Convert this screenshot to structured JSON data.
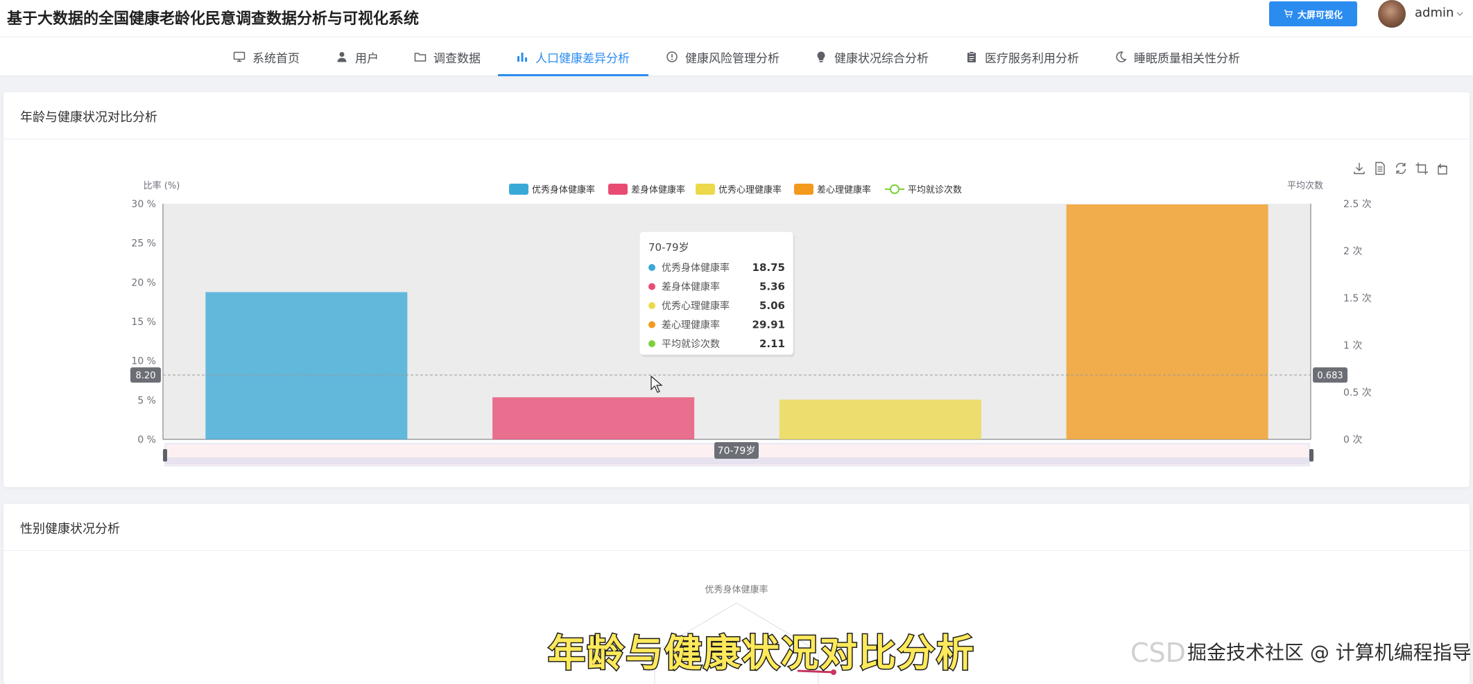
{
  "app": {
    "title": "基于大数据的全国健康老龄化民意调查数据分析与可视化系统",
    "bigscreen_label": "大屏可视化",
    "user": "admin"
  },
  "nav": {
    "items": [
      {
        "label": "系统首页",
        "icon": "monitor-icon"
      },
      {
        "label": "用户",
        "icon": "user-icon"
      },
      {
        "label": "调查数据",
        "icon": "folder-icon"
      },
      {
        "label": "人口健康差异分析",
        "icon": "bar-chart-icon",
        "active": true
      },
      {
        "label": "健康风险管理分析",
        "icon": "info-circle-icon"
      },
      {
        "label": "健康状况综合分析",
        "icon": "lightbulb-icon"
      },
      {
        "label": "医疗服务利用分析",
        "icon": "clipboard-icon"
      },
      {
        "label": "睡眠质量相关性分析",
        "icon": "moon-icon"
      }
    ]
  },
  "card1": {
    "title": "年龄与健康状况对比分析"
  },
  "card2": {
    "title": "性别健康状况分析"
  },
  "chart_data": [
    {
      "type": "bar",
      "ylabel_left": "比率 (%)",
      "ylabel_right": "平均次数",
      "y_left": {
        "min": 0,
        "max": 30,
        "ticks": [
          0,
          5,
          10,
          15,
          20,
          25,
          30
        ],
        "tick_suffix": " %"
      },
      "y_right": {
        "min": 0,
        "max": 2.5,
        "ticks": [
          0,
          0.5,
          1,
          1.5,
          2,
          2.5
        ],
        "tick_suffix": " 次"
      },
      "categories": [
        "70-79岁"
      ],
      "series": [
        {
          "name": "优秀身体健康率",
          "color": "#3ba9d6",
          "values": [
            18.75
          ],
          "type": "bar"
        },
        {
          "name": "差身体健康率",
          "color": "#e84c73",
          "values": [
            5.36
          ],
          "type": "bar"
        },
        {
          "name": "优秀心理健康率",
          "color": "#ecd84a",
          "values": [
            5.06
          ],
          "type": "bar"
        },
        {
          "name": "差心理健康率",
          "color": "#f29a1e",
          "values": [
            29.91
          ],
          "type": "bar"
        },
        {
          "name": "平均就诊次数",
          "color": "#7dd03c",
          "values": [
            2.11
          ],
          "type": "line"
        }
      ],
      "tooltip": {
        "title": "70-79岁",
        "rows": [
          {
            "name": "优秀身体健康率",
            "value": "18.75",
            "color": "#3ba9d6"
          },
          {
            "name": "差身体健康率",
            "value": "5.36",
            "color": "#e84c73"
          },
          {
            "name": "优秀心理健康率",
            "value": "5.06",
            "color": "#ecd84a"
          },
          {
            "name": "差心理健康率",
            "value": "29.91",
            "color": "#f29a1e"
          },
          {
            "name": "平均就诊次数",
            "value": "2.11",
            "color": "#7dd03c"
          }
        ]
      },
      "crosshair": {
        "left_value": "8.20",
        "right_value": "0.683",
        "left_numeric": 8.2
      },
      "axis_pointer_label": "70-79岁",
      "grid": false,
      "legend_position": "top-center",
      "toolbox": [
        "download-icon",
        "data-view-icon",
        "restore-icon",
        "zoom-icon",
        "zoom-reset-icon"
      ]
    },
    {
      "type": "radar",
      "indicators": [
        "优秀身体健康率"
      ]
    }
  ],
  "overlay": {
    "subtitle": "年龄与健康状况对比分析",
    "watermark_csd": "CSD",
    "watermark_community": "掘金技术社区 @ 计算机编程指导师"
  }
}
